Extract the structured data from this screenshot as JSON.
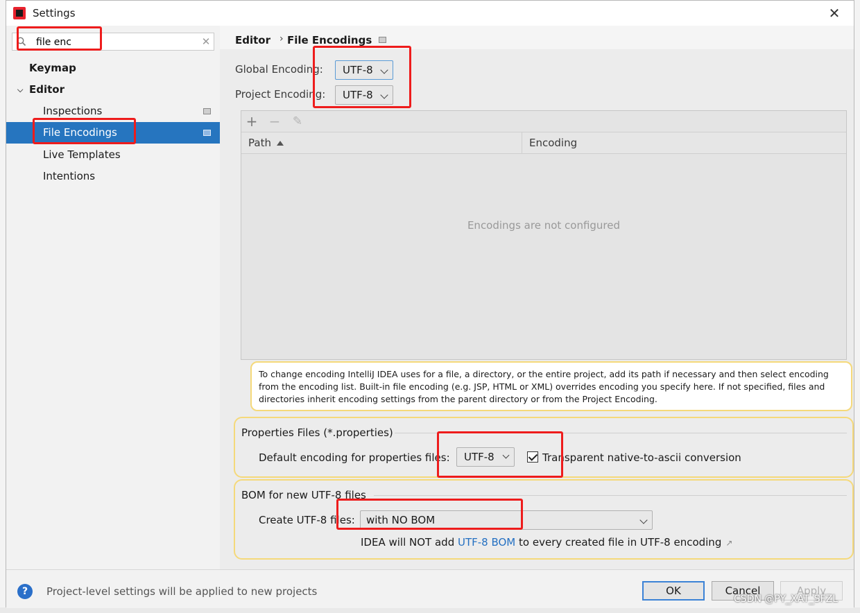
{
  "window": {
    "title": "Settings",
    "close_label": "✕"
  },
  "search": {
    "value": "file enc",
    "clear_label": "✕"
  },
  "sidebar": {
    "items": [
      {
        "label": "Keymap"
      },
      {
        "label": "Editor",
        "chevron": "⌵"
      },
      {
        "label": "Inspections"
      },
      {
        "label": "File Encodings"
      },
      {
        "label": "Live Templates"
      },
      {
        "label": "Intentions"
      }
    ]
  },
  "breadcrumb": {
    "parent": "Editor",
    "separator": "›",
    "current": "File Encodings"
  },
  "encoding": {
    "global_label": "Global Encoding:",
    "global_value": "UTF-8",
    "project_label": "Project Encoding:",
    "project_value": "UTF-8"
  },
  "table": {
    "toolbar": {
      "add": "+",
      "remove": "−",
      "edit": "✎"
    },
    "columns": [
      "Path",
      "Encoding"
    ],
    "empty_text": "Encodings are not configured"
  },
  "info_text": "To change encoding IntelliJ IDEA uses for a file, a directory, or the entire project, add its path if necessary and then select encoding from the encoding list. Built-in file encoding (e.g. JSP, HTML or XML) overrides encoding you specify here. If not specified, files and directories inherit encoding settings from the parent directory or from the Project Encoding.",
  "properties": {
    "title": "Properties Files (*.properties)",
    "default_label": "Default encoding for properties files:",
    "default_value": "UTF-8",
    "transparent_label": "Transparent native-to-ascii conversion",
    "transparent_checked": true
  },
  "bom": {
    "title": "BOM for new UTF-8 files",
    "create_label": "Create UTF-8 files:",
    "create_value": "with NO BOM",
    "note_prefix": "IDEA will NOT add ",
    "note_link": "UTF-8 BOM",
    "note_suffix": " to every created file in UTF-8 encoding",
    "note_arrow": "↗"
  },
  "footer": {
    "help_icon": "?",
    "text": "Project-level settings will be applied to new projects",
    "ok": "OK",
    "cancel": "Cancel",
    "apply": "Apply"
  },
  "watermark": "CSDN @PY_XAT_SFZL",
  "colors": {
    "selection": "#2675bf",
    "highlight_box": "#ee1c1c",
    "group_border": "#f5d97a",
    "link": "#2470c2"
  },
  "icons": {
    "app": "intellij-idea-icon",
    "search": "search-icon",
    "project_scope": "project-scope-icon"
  }
}
